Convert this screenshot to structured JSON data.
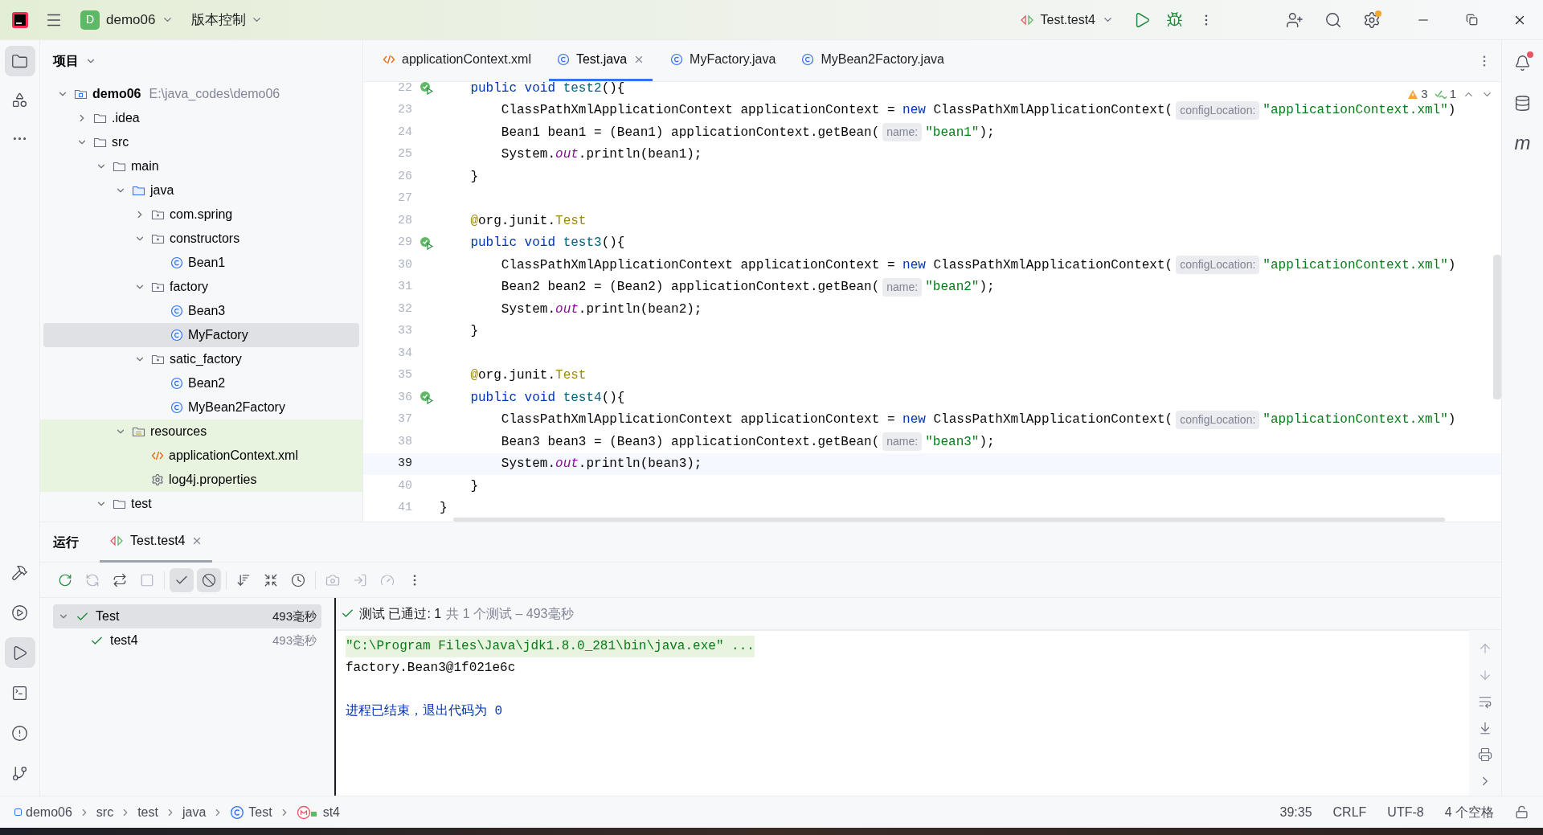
{
  "title_bar": {
    "project_badge": "D",
    "project": "demo06",
    "vcs": "版本控制",
    "run_config": "Test.test4"
  },
  "tool_strip_top": [
    {
      "kind": "project",
      "selected": true
    },
    {
      "kind": "structure",
      "selected": false
    },
    {
      "kind": "more",
      "selected": false
    }
  ],
  "tool_strip_bottom": [
    {
      "kind": "build",
      "selected": false
    },
    {
      "kind": "services",
      "selected": false
    },
    {
      "kind": "run",
      "selected": true
    },
    {
      "kind": "terminal",
      "selected": false
    },
    {
      "kind": "problems",
      "selected": false
    },
    {
      "kind": "git",
      "selected": false
    }
  ],
  "project": {
    "title": "项目",
    "tree": [
      {
        "label": "demo06",
        "kind": "module",
        "path": "E:\\java_codes\\demo06",
        "selected": false,
        "highlighted": false,
        "expanded": true,
        "children": [
          {
            "label": ".idea",
            "kind": "folder",
            "selected": false,
            "highlighted": false,
            "expanded": false
          },
          {
            "label": "src",
            "kind": "folder",
            "selected": false,
            "highlighted": false,
            "expanded": true,
            "children": [
              {
                "label": "main",
                "kind": "folder",
                "selected": false,
                "highlighted": false,
                "expanded": true,
                "children": [
                  {
                    "label": "java",
                    "kind": "source_folder",
                    "selected": false,
                    "highlighted": false,
                    "expanded": true,
                    "children": [
                      {
                        "label": "com.spring",
                        "kind": "package",
                        "selected": false,
                        "highlighted": false,
                        "expanded": false
                      },
                      {
                        "label": "constructors",
                        "kind": "package",
                        "selected": false,
                        "highlighted": false,
                        "expanded": true,
                        "children": [
                          {
                            "label": "Bean1",
                            "kind": "class",
                            "selected": false,
                            "highlighted": false
                          }
                        ]
                      },
                      {
                        "label": "factory",
                        "kind": "package",
                        "selected": false,
                        "highlighted": false,
                        "expanded": true,
                        "children": [
                          {
                            "label": "Bean3",
                            "kind": "class",
                            "selected": false,
                            "highlighted": false
                          },
                          {
                            "label": "MyFactory",
                            "kind": "class",
                            "selected": true,
                            "highlighted": false
                          }
                        ]
                      },
                      {
                        "label": "satic_factory",
                        "kind": "package",
                        "selected": false,
                        "highlighted": false,
                        "expanded": true,
                        "children": [
                          {
                            "label": "Bean2",
                            "kind": "class",
                            "selected": false,
                            "highlighted": false
                          },
                          {
                            "label": "MyBean2Factory",
                            "kind": "class",
                            "selected": false,
                            "highlighted": false
                          }
                        ]
                      }
                    ]
                  },
                  {
                    "label": "resources",
                    "kind": "resource_folder",
                    "selected": false,
                    "highlighted": true,
                    "expanded": true,
                    "children": [
                      {
                        "label": "applicationContext.xml",
                        "kind": "xml",
                        "selected": false,
                        "highlighted": true
                      },
                      {
                        "label": "log4j.properties",
                        "kind": "properties",
                        "selected": false,
                        "highlighted": true
                      }
                    ]
                  }
                ]
              },
              {
                "label": "test",
                "kind": "folder",
                "selected": false,
                "highlighted": false,
                "expanded": true
              }
            ]
          }
        ]
      }
    ]
  },
  "editor": {
    "tabs": [
      {
        "label": "applicationContext.xml",
        "kind": "xml",
        "selected": false,
        "closable": false
      },
      {
        "label": "Test.java",
        "kind": "class",
        "selected": true,
        "closable": true
      },
      {
        "label": "MyFactory.java",
        "kind": "class",
        "selected": false,
        "closable": false
      },
      {
        "label": "MyBean2Factory.java",
        "kind": "class",
        "selected": false,
        "closable": false
      }
    ],
    "inspections": {
      "warnings": "3",
      "weak_warnings": "1"
    },
    "lines": [
      {
        "number": "22",
        "run_marker": true,
        "current": false,
        "tokens": [
          {
            "kind": "keyword",
            "text": "    public void "
          },
          {
            "kind": "def",
            "text": "test2"
          },
          {
            "kind": "plain",
            "text": "(){"
          }
        ]
      },
      {
        "number": "23",
        "run_marker": false,
        "current": false,
        "tokens": [
          {
            "kind": "plain",
            "text": "        ClassPathXmlApplicationContext applicationContext = "
          },
          {
            "kind": "keyword",
            "text": "new "
          },
          {
            "kind": "plain",
            "text": "ClassPathXmlApplicationContext("
          },
          {
            "kind": "hint",
            "text": "configLocation:"
          },
          {
            "kind": "string",
            "text": "\"applicationContext.xml\""
          },
          {
            "kind": "plain",
            "text": ")"
          }
        ]
      },
      {
        "number": "24",
        "run_marker": false,
        "current": false,
        "tokens": [
          {
            "kind": "plain",
            "text": "        Bean1 bean1 = (Bean1) applicationContext.getBean("
          },
          {
            "kind": "hint",
            "text": "name:"
          },
          {
            "kind": "string",
            "text": "\"bean1\""
          },
          {
            "kind": "plain",
            "text": ");"
          }
        ]
      },
      {
        "number": "25",
        "run_marker": false,
        "current": false,
        "tokens": [
          {
            "kind": "plain",
            "text": "        System."
          },
          {
            "kind": "field",
            "text": "out"
          },
          {
            "kind": "plain",
            "text": ".println(bean1);"
          }
        ]
      },
      {
        "number": "26",
        "run_marker": false,
        "current": false,
        "tokens": [
          {
            "kind": "plain",
            "text": "    }"
          }
        ]
      },
      {
        "number": "27",
        "run_marker": false,
        "current": false
      },
      {
        "number": "28",
        "run_marker": false,
        "current": false,
        "tokens": [
          {
            "kind": "annotation",
            "text": "    @"
          },
          {
            "kind": "plain",
            "text": "org.junit."
          },
          {
            "kind": "annotation",
            "text": "Test"
          }
        ]
      },
      {
        "number": "29",
        "run_marker": true,
        "current": false,
        "tokens": [
          {
            "kind": "keyword",
            "text": "    public void "
          },
          {
            "kind": "def",
            "text": "test3"
          },
          {
            "kind": "plain",
            "text": "(){"
          }
        ]
      },
      {
        "number": "30",
        "run_marker": false,
        "current": false,
        "tokens": [
          {
            "kind": "plain",
            "text": "        ClassPathXmlApplicationContext applicationContext = "
          },
          {
            "kind": "keyword",
            "text": "new "
          },
          {
            "kind": "plain",
            "text": "ClassPathXmlApplicationContext("
          },
          {
            "kind": "hint",
            "text": "configLocation:"
          },
          {
            "kind": "string",
            "text": "\"applicationContext.xml\""
          },
          {
            "kind": "plain",
            "text": ")"
          }
        ]
      },
      {
        "number": "31",
        "run_marker": false,
        "current": false,
        "tokens": [
          {
            "kind": "plain",
            "text": "        Bean2 bean2 = (Bean2) applicationContext.getBean("
          },
          {
            "kind": "hint",
            "text": "name:"
          },
          {
            "kind": "string",
            "text": "\"bean2\""
          },
          {
            "kind": "plain",
            "text": ");"
          }
        ]
      },
      {
        "number": "32",
        "run_marker": false,
        "current": false,
        "tokens": [
          {
            "kind": "plain",
            "text": "        System."
          },
          {
            "kind": "field",
            "text": "out"
          },
          {
            "kind": "plain",
            "text": ".println(bean2);"
          }
        ]
      },
      {
        "number": "33",
        "run_marker": false,
        "current": false,
        "tokens": [
          {
            "kind": "plain",
            "text": "    }"
          }
        ]
      },
      {
        "number": "34",
        "run_marker": false,
        "current": false
      },
      {
        "number": "35",
        "run_marker": false,
        "current": false,
        "tokens": [
          {
            "kind": "annotation",
            "text": "    @"
          },
          {
            "kind": "plain",
            "text": "org.junit."
          },
          {
            "kind": "annotation",
            "text": "Test"
          }
        ]
      },
      {
        "number": "36",
        "run_marker": true,
        "current": false,
        "tokens": [
          {
            "kind": "keyword",
            "text": "    public void "
          },
          {
            "kind": "def",
            "text": "test4"
          },
          {
            "kind": "plain",
            "text": "(){"
          }
        ]
      },
      {
        "number": "37",
        "run_marker": false,
        "current": false,
        "tokens": [
          {
            "kind": "plain",
            "text": "        ClassPathXmlApplicationContext applicationContext = "
          },
          {
            "kind": "keyword",
            "text": "new "
          },
          {
            "kind": "plain",
            "text": "ClassPathXmlApplicationContext("
          },
          {
            "kind": "hint",
            "text": "configLocation:"
          },
          {
            "kind": "string",
            "text": "\"applicationContext.xml\""
          },
          {
            "kind": "plain",
            "text": ")"
          }
        ]
      },
      {
        "number": "38",
        "run_marker": false,
        "current": false,
        "tokens": [
          {
            "kind": "plain",
            "text": "        Bean3 bean3 = (Bean3) applicationContext.getBean("
          },
          {
            "kind": "hint",
            "text": "name:"
          },
          {
            "kind": "string",
            "text": "\"bean3\""
          },
          {
            "kind": "plain",
            "text": ");"
          }
        ]
      },
      {
        "number": "39",
        "run_marker": false,
        "current": true,
        "tokens": [
          {
            "kind": "plain",
            "text": "        System."
          },
          {
            "kind": "field",
            "text": "out"
          },
          {
            "kind": "plain",
            "text": ".println(bean3);"
          }
        ]
      },
      {
        "number": "40",
        "run_marker": false,
        "current": false,
        "tokens": [
          {
            "kind": "plain",
            "text": "    }"
          }
        ]
      },
      {
        "number": "41",
        "run_marker": false,
        "current": false,
        "tokens": [
          {
            "kind": "plain",
            "text": "}"
          }
        ]
      }
    ]
  },
  "right_strip": [
    {
      "kind": "notifications",
      "badge": true
    },
    {
      "kind": "database",
      "badge": false
    },
    {
      "kind": "maven",
      "badge": false,
      "label": "m"
    }
  ],
  "run": {
    "title": "运行",
    "tabs": [
      {
        "label": "Test.test4",
        "selected": true,
        "closable": true
      }
    ],
    "toggles": [
      {
        "kind": "show_passed",
        "on": true
      },
      {
        "kind": "show_ignored",
        "on": true
      }
    ],
    "tests": [
      {
        "name": "Test",
        "time": "493毫秒",
        "selected": true,
        "expanded": true,
        "children": [
          {
            "name": "test4",
            "time": "493毫秒",
            "selected": false
          }
        ]
      }
    ],
    "summary": "测试 已通过: 1",
    "summary_detail": "共 1 个测试 – 493毫秒",
    "console": [
      {
        "kind": "command",
        "text": "\"C:\\Program Files\\Java\\jdk1.8.0_281\\bin\\java.exe\" ..."
      },
      {
        "kind": "output",
        "text": "factory.Bean3@1f021e6c"
      },
      {
        "kind": "exit",
        "text": "进程已结束，退出代码为 0"
      }
    ]
  },
  "status_bar": {
    "breadcrumbs": [
      {
        "label": "demo06",
        "kind": "module"
      },
      {
        "label": "src",
        "kind": "plain"
      },
      {
        "label": "test",
        "kind": "plain"
      },
      {
        "label": "java",
        "kind": "plain"
      },
      {
        "label": "Test",
        "kind": "class"
      },
      {
        "label": "st4",
        "kind": "method"
      }
    ],
    "position": "39:35",
    "line_separator": "CRLF",
    "encoding": "UTF-8",
    "indent": "4 个空格"
  }
}
